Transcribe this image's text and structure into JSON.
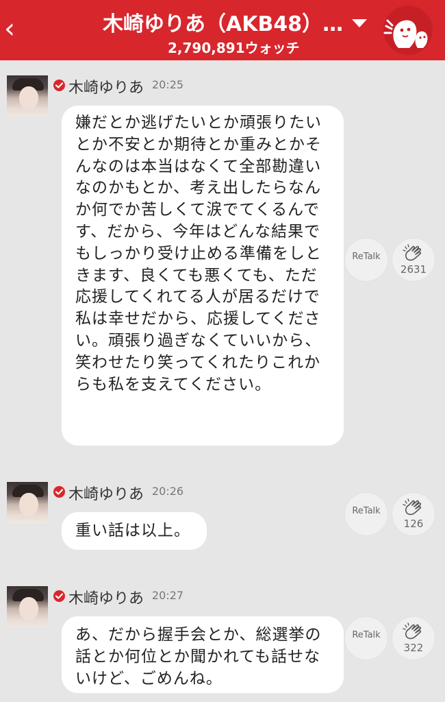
{
  "header": {
    "back_icon": "chevron-left-icon",
    "title": "木崎ゆりあ（AKB48）…",
    "watch_count": "2,790,891ウォッチ",
    "dropdown_icon": "caret-down-icon",
    "logo_icon": "ghost-mascot-icon",
    "color": "#d8262d"
  },
  "messages": [
    {
      "name": "木崎ゆりあ",
      "time": "20:25",
      "text": "嫌だとか逃げたいとか頑張りたいとか不安とか期待とか重みとかそんなのは本当はなくて全部勘違いなのかもとか、考え出したらなんか何でか苦しくて涙でてくるんです、だから、今年はどんな結果でもしっかり受け止める準備をしときます、良くても悪くても、ただ応援してくれてる人が居るだけで私は幸せだから、応援してください。頑張り過ぎなくていいから、笑わせたり笑ってくれたりこれからも私を支えてください。",
      "retalk_label": "ReTalk",
      "clap_count": "2631"
    },
    {
      "name": "木崎ゆりあ",
      "time": "20:26",
      "text": "重い話は以上。",
      "retalk_label": "ReTalk",
      "clap_count": "126"
    },
    {
      "name": "木崎ゆりあ",
      "time": "20:27",
      "text": "あ、だから握手会とか、総選挙の話とか何位とか聞かれても話せないけど、ごめんね。",
      "retalk_label": "ReTalk",
      "clap_count": "322"
    }
  ]
}
